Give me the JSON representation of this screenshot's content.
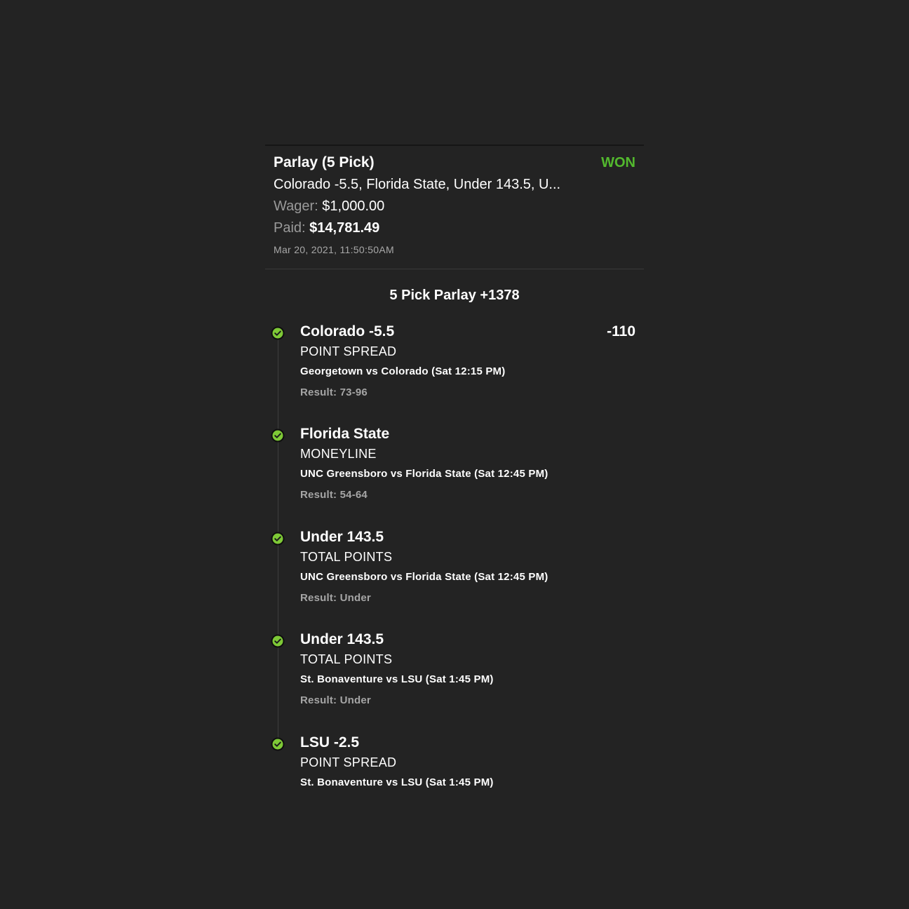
{
  "bet": {
    "title": "Parlay (5 Pick)",
    "status": "WON",
    "summary": "Colorado -5.5, Florida State, Under 143.5, U...",
    "wager_label": "Wager:",
    "wager_value": "$1,000.00",
    "paid_label": "Paid:",
    "paid_value": "$14,781.49",
    "timestamp": "Mar 20, 2021, 11:50:50AM"
  },
  "parlay_heading": "5 Pick Parlay +1378",
  "legs": [
    {
      "pick": "Colorado -5.5",
      "odds": "-110",
      "market": "POINT SPREAD",
      "event": "Georgetown vs Colorado (Sat 12:15 PM)",
      "result": "Result: 73-96"
    },
    {
      "pick": "Florida State",
      "odds": "",
      "market": "MONEYLINE",
      "event": "UNC Greensboro vs Florida State (Sat 12:45 PM)",
      "result": "Result: 54-64"
    },
    {
      "pick": "Under 143.5",
      "odds": "",
      "market": "TOTAL POINTS",
      "event": "UNC Greensboro vs Florida State (Sat 12:45 PM)",
      "result": "Result: Under"
    },
    {
      "pick": "Under 143.5",
      "odds": "",
      "market": "TOTAL POINTS",
      "event": "St. Bonaventure vs LSU (Sat 1:45 PM)",
      "result": "Result: Under"
    },
    {
      "pick": "LSU -2.5",
      "odds": "",
      "market": "POINT SPREAD",
      "event": "St. Bonaventure vs LSU (Sat 1:45 PM)",
      "result": ""
    }
  ],
  "colors": {
    "background": "#232323",
    "won_green": "#53b92e",
    "check_green": "#7ec936",
    "muted_text": "#9a9a9a"
  },
  "icons": {
    "leg_status": "check-circle-icon"
  }
}
